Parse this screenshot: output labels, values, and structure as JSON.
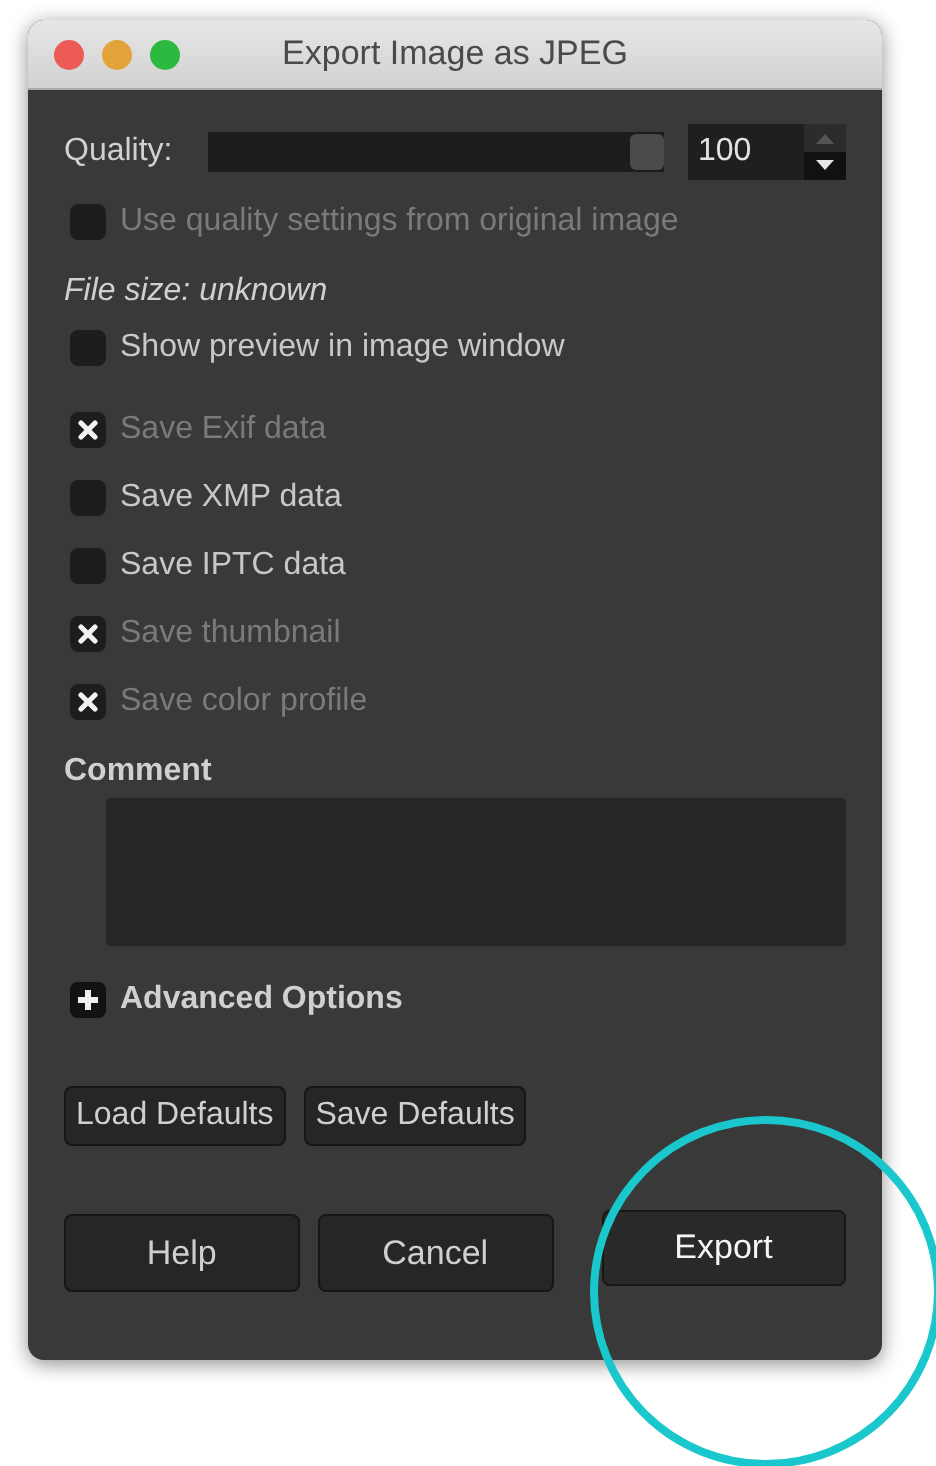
{
  "window": {
    "title": "Export Image as JPEG"
  },
  "quality": {
    "label": "Quality:",
    "level": 1.0,
    "value": "100"
  },
  "quality_option": {
    "label": "Use quality settings from original image",
    "checked": false,
    "disabled": true
  },
  "file_size": "File size: unknown",
  "preview_option": {
    "label": "Show preview in image window",
    "checked": false,
    "disabled": false
  },
  "metadata_options": [
    {
      "label": "Save Exif data",
      "checked": true,
      "disabled": true
    },
    {
      "label": "Save XMP data",
      "checked": false,
      "disabled": false
    },
    {
      "label": "Save IPTC data",
      "checked": false,
      "disabled": false
    },
    {
      "label": "Save thumbnail",
      "checked": true,
      "disabled": true
    },
    {
      "label": "Save color profile",
      "checked": true,
      "disabled": true
    }
  ],
  "comment": {
    "label": "Comment"
  },
  "advanced": {
    "label": "Advanced Options",
    "expanded": false
  },
  "default_buttons": [
    "Load Defaults",
    "Save Defaults"
  ],
  "buttons": [
    {
      "label": "Help",
      "highlighted": false
    },
    {
      "label": "Cancel",
      "highlighted": false
    },
    {
      "label": "Export",
      "highlighted": true
    }
  ]
}
